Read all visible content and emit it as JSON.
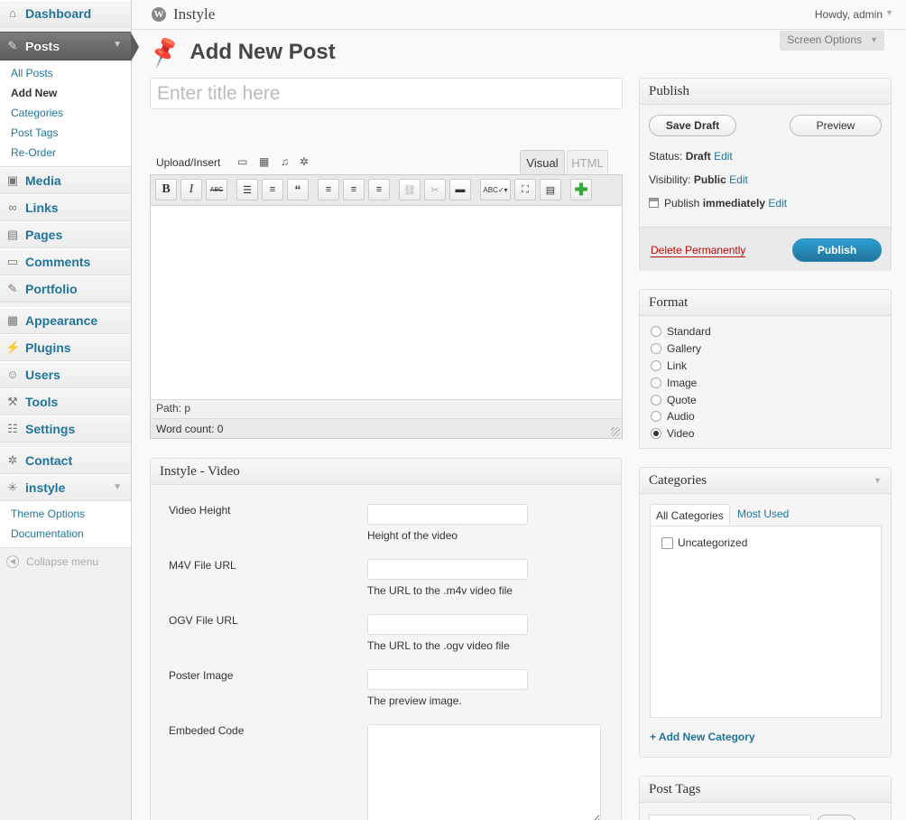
{
  "header": {
    "site_title": "Instyle",
    "howdy": "Howdy, admin",
    "screen_options": "Screen Options"
  },
  "sidebar": {
    "dashboard": "Dashboard",
    "posts": "Posts",
    "posts_sub": [
      "All Posts",
      "Add New",
      "Categories",
      "Post Tags",
      "Re-Order"
    ],
    "media": "Media",
    "links": "Links",
    "pages": "Pages",
    "comments": "Comments",
    "portfolio": "Portfolio",
    "appearance": "Appearance",
    "plugins": "Plugins",
    "users": "Users",
    "tools": "Tools",
    "settings": "Settings",
    "contact": "Contact",
    "instyle": "instyle",
    "instyle_sub": [
      "Theme Options",
      "Documentation"
    ],
    "collapse": "Collapse menu"
  },
  "page": {
    "title": "Add New Post",
    "title_placeholder": "Enter title here"
  },
  "editor": {
    "upload_label": "Upload/Insert",
    "tab_visual": "Visual",
    "tab_html": "HTML",
    "path": "Path: p",
    "word_count": "Word count: 0"
  },
  "video_box": {
    "title": "Instyle - Video",
    "fields": [
      {
        "label": "Video Height",
        "desc": "Height of the video"
      },
      {
        "label": "M4V File URL",
        "desc": "The URL to the .m4v video file"
      },
      {
        "label": "OGV File URL",
        "desc": "The URL to the .ogv video file"
      },
      {
        "label": "Poster Image",
        "desc": "The preview image."
      },
      {
        "label": "Embeded Code",
        "desc": ""
      }
    ]
  },
  "publish": {
    "title": "Publish",
    "save_draft": "Save Draft",
    "preview": "Preview",
    "status_label": "Status:",
    "status_value": "Draft",
    "visibility_label": "Visibility:",
    "visibility_value": "Public",
    "publish_label": "Publish",
    "publish_value": "immediately",
    "edit": "Edit",
    "delete": "Delete Permanently",
    "publish_button": "Publish"
  },
  "format": {
    "title": "Format",
    "options": [
      "Standard",
      "Gallery",
      "Link",
      "Image",
      "Quote",
      "Audio",
      "Video"
    ],
    "selected": "Video"
  },
  "categories": {
    "title": "Categories",
    "tab_all": "All Categories",
    "tab_most": "Most Used",
    "items": [
      "Uncategorized"
    ],
    "add_new": "+ Add New Category"
  },
  "tags": {
    "title": "Post Tags"
  },
  "colors": {
    "link": "#21759b",
    "delete": "#bc0b0b",
    "publish_button": "#21759b"
  }
}
